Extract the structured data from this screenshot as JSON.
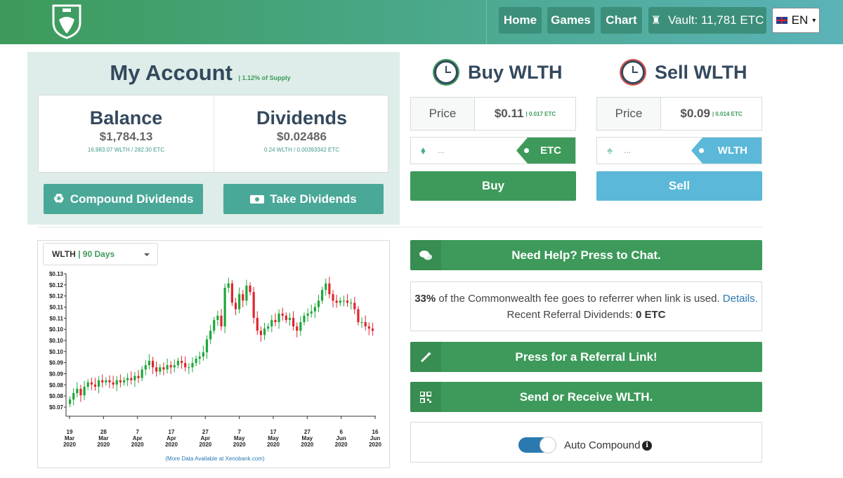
{
  "nav": {
    "home": "Home",
    "games": "Games",
    "chart": "Chart",
    "vault": "Vault: 11,781 ETC",
    "lang": "EN"
  },
  "account": {
    "title": "My Account",
    "supply": "| 1.12% of Supply",
    "balance_label": "Balance",
    "balance_value": "$1,784.13",
    "balance_sub": "16,983.07 WLTH / 282.30 ETC",
    "dividends_label": "Dividends",
    "dividends_value": "$0.02486",
    "dividends_sub": "0.24 WLTH / 0.00393342 ETC",
    "compound_btn": "Compound Dividends",
    "take_btn": "Take Dividends"
  },
  "buy": {
    "title": "Buy WLTH",
    "price_label": "Price",
    "price_value": "$0.11",
    "price_sub": "| 0.017 ETC",
    "placeholder": "...",
    "currency": "ETC",
    "button": "Buy"
  },
  "sell": {
    "title": "Sell WLTH",
    "price_label": "Price",
    "price_value": "$0.09",
    "price_sub": "| 0.014 ETC",
    "placeholder": "...",
    "currency": "WLTH",
    "button": "Sell"
  },
  "chart_select": {
    "token": "WLTH",
    "sep": " | ",
    "range": "90 Days"
  },
  "chart_footer": "(More Data Available at Xenobank.com)",
  "help_btn": "Need Help? Press to Chat.",
  "referral": {
    "pct": "33%",
    "text": " of the Commonwealth fee goes to referrer when link is used. ",
    "details": "Details.",
    "recent_label": "Recent Referral Dividends: ",
    "recent_value": "0 ETC"
  },
  "ref_link_btn": "Press for a Referral Link!",
  "send_btn": "Send or Receive WLTH.",
  "auto_compound": "Auto Compound",
  "colors": {
    "green": "#3d9a5a",
    "teal": "#4aa898",
    "sell_blue": "#5bb8d8",
    "up": "#1ea83a",
    "down": "#e0252f"
  },
  "chart_data": {
    "type": "candlestick",
    "y_ticks": [
      "$0.13",
      "$0.12",
      "$0.12",
      "$0.11",
      "$0.11",
      "$0.10",
      "$0.10",
      "$0.10",
      "$0.09",
      "$0.09",
      "$0.08",
      "$0.08",
      "$0.07"
    ],
    "x_ticks": [
      {
        "d": "19",
        "m": "Mar",
        "y": "2020"
      },
      {
        "d": "28",
        "m": "Mar",
        "y": "2020"
      },
      {
        "d": "7",
        "m": "Apr",
        "y": "2020"
      },
      {
        "d": "17",
        "m": "Apr",
        "y": "2020"
      },
      {
        "d": "27",
        "m": "Apr",
        "y": "2020"
      },
      {
        "d": "7",
        "m": "May",
        "y": "2020"
      },
      {
        "d": "17",
        "m": "May",
        "y": "2020"
      },
      {
        "d": "27",
        "m": "May",
        "y": "2020"
      },
      {
        "d": "6",
        "m": "Jun",
        "y": "2020"
      },
      {
        "d": "16",
        "m": "Jun",
        "y": "2020"
      }
    ],
    "ylim": [
      0.0685,
      0.1305
    ],
    "closes": [
      0.072,
      0.075,
      0.077,
      0.074,
      0.078,
      0.08,
      0.079,
      0.078,
      0.081,
      0.08,
      0.081,
      0.08,
      0.079,
      0.081,
      0.08,
      0.081,
      0.082,
      0.081,
      0.083,
      0.082,
      0.086,
      0.088,
      0.09,
      0.087,
      0.085,
      0.087,
      0.086,
      0.088,
      0.087,
      0.088,
      0.09,
      0.089,
      0.087,
      0.087,
      0.089,
      0.091,
      0.092,
      0.094,
      0.1,
      0.104,
      0.109,
      0.111,
      0.106,
      0.124,
      0.126,
      0.117,
      0.114,
      0.121,
      0.118,
      0.125,
      0.122,
      0.11,
      0.104,
      0.102,
      0.105,
      0.106,
      0.109,
      0.108,
      0.112,
      0.111,
      0.109,
      0.11,
      0.106,
      0.104,
      0.108,
      0.111,
      0.112,
      0.113,
      0.115,
      0.118,
      0.123,
      0.126,
      0.121,
      0.118,
      0.117,
      0.118,
      0.118,
      0.117,
      0.117,
      0.114,
      0.108,
      0.108,
      0.106,
      0.105,
      0.104
    ]
  }
}
